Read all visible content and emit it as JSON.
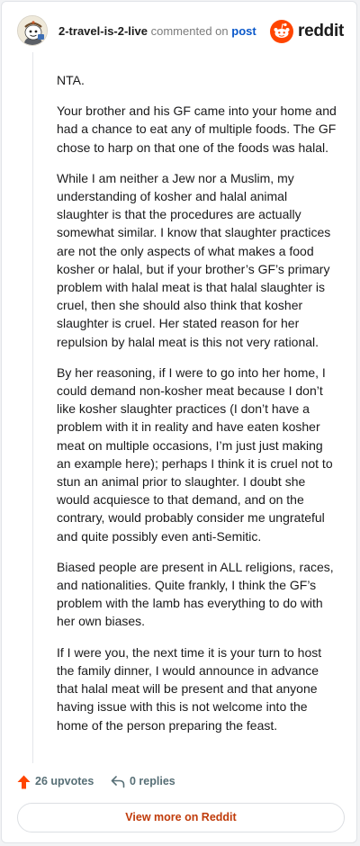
{
  "header": {
    "username": "2-travel-is-2-live",
    "commented_on": "commented on",
    "post_link": "post",
    "brand": "reddit"
  },
  "comment": {
    "paragraphs": [
      "NTA.",
      "Your brother and his GF came into your home and had a chance to eat any of multiple foods. The GF chose to harp on that one of the foods was halal.",
      "While I am neither a Jew nor a Muslim, my understanding of kosher and halal animal slaughter is that the procedures are actually somewhat similar. I know that slaughter practices are not the only aspects of what makes a food kosher or halal, but if your brother’s GF’s primary problem with halal meat is that halal slaughter is cruel, then she should also think that kosher slaughter is cruel. Her stated reason for her repulsion by halal meat is this not very rational.",
      "By her reasoning, if I were to go into her home, I could demand non-kosher meat because I don’t like kosher slaughter practices (I don’t have a problem with it in reality and have eaten kosher meat on multiple occasions, I’m just just making an example here); perhaps I think it is cruel not to stun an animal prior to slaughter. I doubt she would acquiesce to that demand, and on the contrary, would probably consider me ungrateful and quite possibly even anti-Semitic.",
      "Biased people are present in ALL religions, races, and nationalities. Quite frankly, I think the GF’s problem with the lamb has everything to do with her own biases.",
      "If I were you, the next time it is your turn to host the family dinner, I would announce in advance that halal meat will be present and that anyone having issue with this is not welcome into the home of the person preparing the feast."
    ]
  },
  "footer": {
    "upvotes": "26 upvotes",
    "replies": "0 replies",
    "view_more": "View more on Reddit"
  },
  "colors": {
    "accent": "#ff4500",
    "link": "#0a58ca",
    "view_more": "#c03b0a",
    "meta": "#576f76"
  },
  "icons": {
    "avatar": "snoo-avatar",
    "brand": "reddit-logo-icon",
    "upvote": "upvote-arrow-icon",
    "reply": "reply-arrow-icon"
  }
}
